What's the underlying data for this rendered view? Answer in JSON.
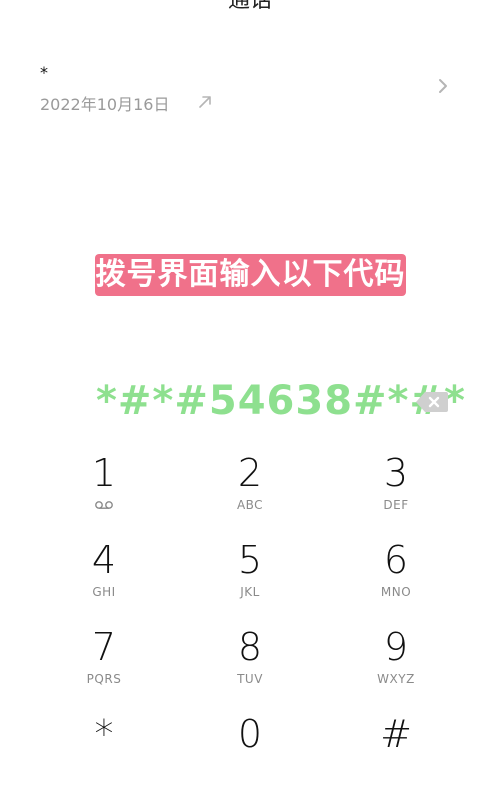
{
  "header": {
    "title": "通话"
  },
  "call_log": {
    "name": "*",
    "date": "2022年10月16日"
  },
  "banner": {
    "text": "拨号界面输入以下代码"
  },
  "dialer": {
    "input_value": "*#*#54638#*#*"
  },
  "keypad": {
    "keys": [
      {
        "digit": "1",
        "letters": ""
      },
      {
        "digit": "2",
        "letters": "ABC"
      },
      {
        "digit": "3",
        "letters": "DEF"
      },
      {
        "digit": "4",
        "letters": "GHI"
      },
      {
        "digit": "5",
        "letters": "JKL"
      },
      {
        "digit": "6",
        "letters": "MNO"
      },
      {
        "digit": "7",
        "letters": "PQRS"
      },
      {
        "digit": "8",
        "letters": "TUV"
      },
      {
        "digit": "9",
        "letters": "WXYZ"
      },
      {
        "digit": "*",
        "letters": ""
      },
      {
        "digit": "0",
        "letters": ""
      },
      {
        "digit": "#",
        "letters": ""
      }
    ]
  },
  "colors": {
    "banner_bg": "#f0718a",
    "dial_text": "#8ee08f",
    "secondary_text": "#9a9a9a"
  }
}
